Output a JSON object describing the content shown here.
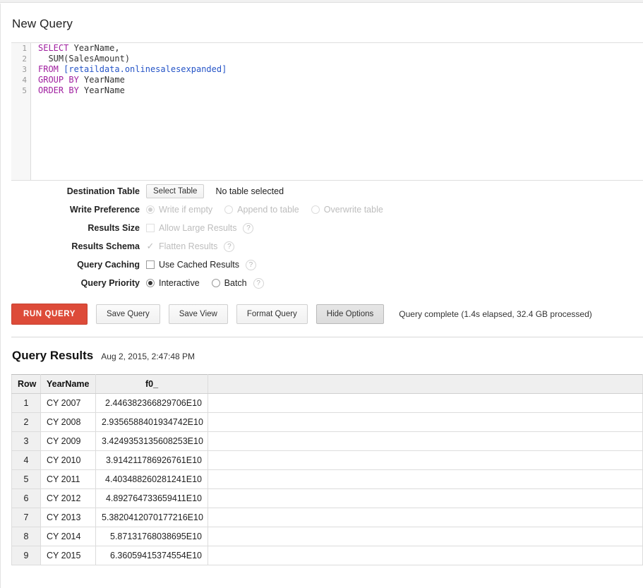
{
  "page": {
    "title": "New Query"
  },
  "editor": {
    "line_numbers": [
      "1",
      "2",
      "3",
      "4",
      "5"
    ],
    "lines": [
      {
        "tokens": [
          {
            "t": "SELECT",
            "k": "kw"
          },
          {
            "t": " YearName,",
            "k": "ident"
          }
        ]
      },
      {
        "tokens": [
          {
            "t": "  SUM(SalesAmount)",
            "k": "ident"
          }
        ]
      },
      {
        "tokens": [
          {
            "t": "FROM",
            "k": "kw"
          },
          {
            "t": " ",
            "k": "ident"
          },
          {
            "t": "[retaildata.onlinesalesexpanded]",
            "k": "tbl"
          }
        ]
      },
      {
        "tokens": [
          {
            "t": "GROUP",
            "k": "kw"
          },
          {
            "t": " ",
            "k": "ident"
          },
          {
            "t": "BY",
            "k": "kw"
          },
          {
            "t": " YearName",
            "k": "ident"
          }
        ]
      },
      {
        "tokens": [
          {
            "t": "ORDER",
            "k": "kw"
          },
          {
            "t": " ",
            "k": "ident"
          },
          {
            "t": "BY",
            "k": "kw"
          },
          {
            "t": " YearName",
            "k": "ident"
          }
        ]
      }
    ]
  },
  "options": {
    "destination_table": {
      "label": "Destination Table",
      "button_label": "Select Table",
      "status": "No table selected"
    },
    "write_preference": {
      "label": "Write Preference",
      "choices": [
        "Write if empty",
        "Append to table",
        "Overwrite table"
      ],
      "selected": "Write if empty"
    },
    "results_size": {
      "label": "Results Size",
      "checkbox_label": "Allow Large Results",
      "checked": false,
      "help": "?"
    },
    "results_schema": {
      "label": "Results Schema",
      "checkbox_label": "Flatten Results",
      "checked": true,
      "help": "?"
    },
    "query_caching": {
      "label": "Query Caching",
      "checkbox_label": "Use Cached Results",
      "checked": false,
      "help": "?"
    },
    "query_priority": {
      "label": "Query Priority",
      "choices": [
        "Interactive",
        "Batch"
      ],
      "selected": "Interactive",
      "help": "?"
    }
  },
  "actions": {
    "run_query": "RUN QUERY",
    "save_query": "Save Query",
    "save_view": "Save View",
    "format_query": "Format Query",
    "hide_options": "Hide Options",
    "status": "Query complete (1.4s elapsed, 32.4 GB processed)"
  },
  "results": {
    "title": "Query Results",
    "timestamp": "Aug 2, 2015, 2:47:48 PM",
    "columns": [
      "Row",
      "YearName",
      "f0_",
      ""
    ],
    "rows": [
      {
        "row": "1",
        "year": "CY 2007",
        "f0": "2.446382366829706E10"
      },
      {
        "row": "2",
        "year": "CY 2008",
        "f0": "2.9356588401934742E10"
      },
      {
        "row": "3",
        "year": "CY 2009",
        "f0": "3.4249353135608253E10"
      },
      {
        "row": "4",
        "year": "CY 2010",
        "f0": "3.914211786926761E10"
      },
      {
        "row": "5",
        "year": "CY 2011",
        "f0": "4.403488260281241E10"
      },
      {
        "row": "6",
        "year": "CY 2012",
        "f0": "4.892764733659411E10"
      },
      {
        "row": "7",
        "year": "CY 2013",
        "f0": "5.3820412070177216E10"
      },
      {
        "row": "8",
        "year": "CY 2014",
        "f0": "5.87131768038695E10"
      },
      {
        "row": "9",
        "year": "CY 2015",
        "f0": "6.36059415374554E10"
      }
    ]
  },
  "colors": {
    "run_button": "#dd4b39",
    "keyword": "#a020a0",
    "table_ref": "#2554c7",
    "header_bg": "#efefef"
  }
}
